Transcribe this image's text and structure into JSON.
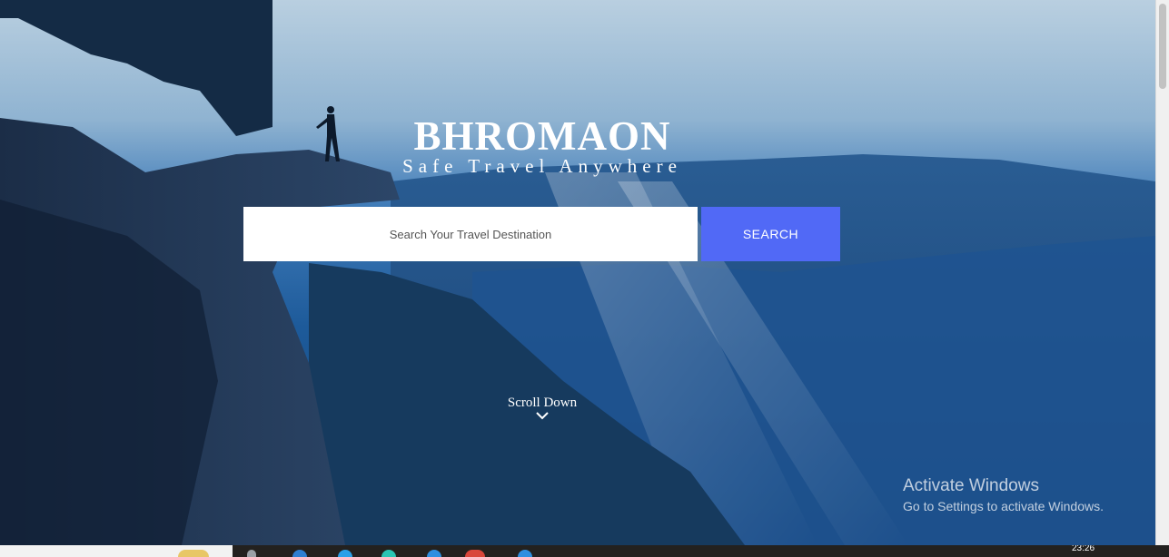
{
  "brand": {
    "title": "BHROMAON",
    "tagline": "Safe Travel Anywhere"
  },
  "search": {
    "placeholder": "Search Your Travel Destination",
    "button_label": "SEARCH"
  },
  "scroll": {
    "label": "Scroll Down",
    "icon": "chevron-down-icon"
  },
  "watermark": {
    "title": "Activate Windows",
    "subtitle": "Go to Settings to activate Windows."
  },
  "taskbar": {
    "clock": "23:26"
  },
  "colors": {
    "accent": "#5169f6",
    "text_light": "#ffffff"
  }
}
